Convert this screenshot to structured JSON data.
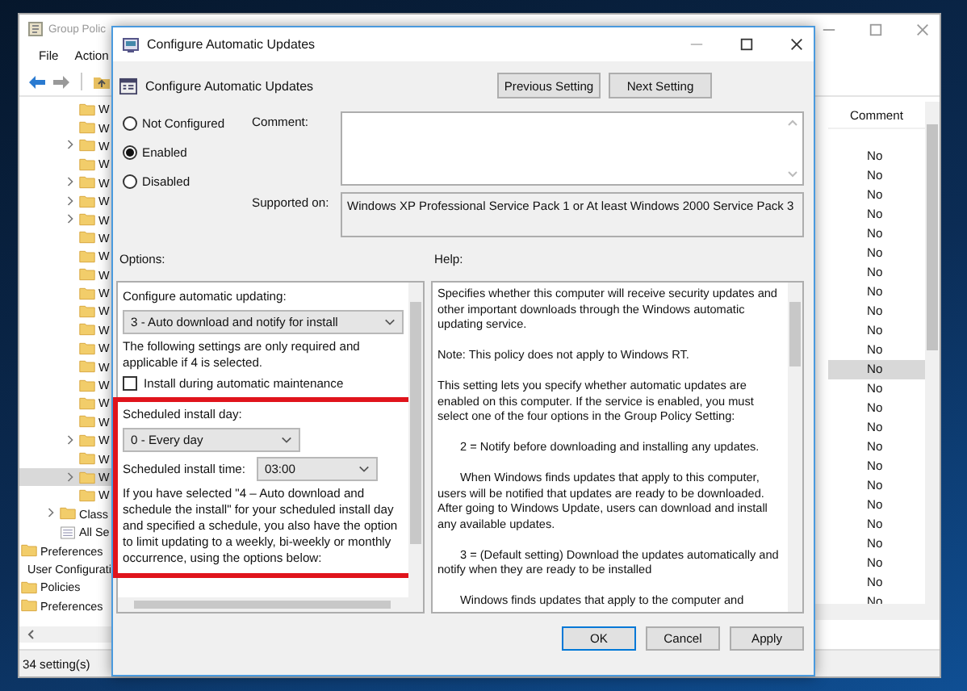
{
  "back_window": {
    "title": "Group Polic",
    "menu": [
      "File",
      "Action"
    ],
    "tree": [
      {
        "children": [
          {
            "children": [
              {
                "children": [
                  {
                    "children": [
                      {
                        "label": "W",
                        "expandable": false,
                        "selected": false
                      },
                      {
                        "label": "W",
                        "expandable": false,
                        "selected": false
                      },
                      {
                        "label": "W",
                        "expandable": true,
                        "selected": false
                      },
                      {
                        "label": "W",
                        "expandable": false,
                        "selected": false
                      },
                      {
                        "label": "W",
                        "expandable": true,
                        "selected": false
                      },
                      {
                        "label": "W",
                        "expandable": true,
                        "selected": false
                      },
                      {
                        "label": "W",
                        "expandable": true,
                        "selected": false
                      },
                      {
                        "label": "W",
                        "expandable": false,
                        "selected": false
                      },
                      {
                        "label": "W",
                        "expandable": false,
                        "selected": false
                      },
                      {
                        "label": "W",
                        "expandable": false,
                        "selected": false
                      },
                      {
                        "label": "W",
                        "expandable": false,
                        "selected": false
                      },
                      {
                        "label": "W",
                        "expandable": false,
                        "selected": false
                      },
                      {
                        "label": "W",
                        "expandable": false,
                        "selected": false
                      },
                      {
                        "label": "W",
                        "expandable": false,
                        "selected": false
                      },
                      {
                        "label": "W",
                        "expandable": false,
                        "selected": false
                      },
                      {
                        "label": "W",
                        "expandable": false,
                        "selected": false
                      },
                      {
                        "label": "W",
                        "expandable": false,
                        "selected": false
                      },
                      {
                        "label": "W",
                        "expandable": false,
                        "selected": false
                      },
                      {
                        "label": "W",
                        "expandable": true,
                        "selected": false
                      },
                      {
                        "label": "W",
                        "expandable": false,
                        "selected": false
                      },
                      {
                        "label": "W",
                        "expandable": true,
                        "selected": true
                      },
                      {
                        "label": "W",
                        "expandable": false,
                        "selected": false
                      }
                    ]
                  },
                  {
                    "label": "Class",
                    "expandable": true,
                    "selected": false
                  },
                  {
                    "label": "All Se",
                    "kind": "settings",
                    "expandable": false,
                    "selected": false
                  }
                ]
              }
            ]
          },
          {
            "label": "Preferences",
            "selected": false
          }
        ]
      },
      {
        "label": "User Configurati",
        "selected": false,
        "children": [
          {
            "label": "Policies",
            "selected": false
          },
          {
            "label": "Preferences",
            "selected": false
          }
        ]
      }
    ],
    "column_header": "Comment",
    "rows": [
      {
        "comment": "No",
        "selected": false
      },
      {
        "comment": "No",
        "selected": false
      },
      {
        "comment": "No",
        "selected": false
      },
      {
        "comment": "No",
        "selected": false
      },
      {
        "comment": "No",
        "selected": false
      },
      {
        "comment": "No",
        "selected": false
      },
      {
        "comment": "No",
        "selected": false
      },
      {
        "comment": "No",
        "selected": false
      },
      {
        "comment": "No",
        "selected": false
      },
      {
        "comment": "No",
        "selected": false
      },
      {
        "comment": "No",
        "selected": false
      },
      {
        "comment": "No",
        "selected": true
      },
      {
        "comment": "No",
        "selected": false
      },
      {
        "comment": "No",
        "selected": false
      },
      {
        "comment": "No",
        "selected": false
      },
      {
        "comment": "No",
        "selected": false
      },
      {
        "comment": "No",
        "selected": false
      },
      {
        "comment": "No",
        "selected": false
      },
      {
        "comment": "No",
        "selected": false
      },
      {
        "comment": "No",
        "selected": false
      },
      {
        "comment": "No",
        "selected": false
      },
      {
        "comment": "No",
        "selected": false
      },
      {
        "comment": "No",
        "selected": false
      },
      {
        "comment": "No",
        "selected": false
      }
    ],
    "status_bar": "34 setting(s)"
  },
  "dialog": {
    "title": "Configure Automatic Updates",
    "heading": "Configure Automatic Updates",
    "nav_buttons": [
      "Previous Setting",
      "Next Setting"
    ],
    "state_options": [
      {
        "label": "Not Configured",
        "selected": false
      },
      {
        "label": "Enabled",
        "selected": true
      },
      {
        "label": "Disabled",
        "selected": false
      }
    ],
    "comment_label": "Comment:",
    "supported_label": "Supported on:",
    "supported_on": "Windows XP Professional Service Pack 1 or At least Windows 2000 Service Pack 3",
    "options_label": "Options:",
    "help_label": "Help:",
    "options": [
      {
        "kind": "label",
        "text": "Configure automatic updating:"
      },
      {
        "kind": "select",
        "value": "3 - Auto download and notify for install"
      },
      {
        "kind": "note",
        "text": "The following settings are only required and applicable if 4 is selected."
      },
      {
        "kind": "checkbox",
        "text": "Install during automatic maintenance",
        "checked": false
      }
    ],
    "highlighted_options": [
      {
        "kind": "label",
        "text": "Scheduled install day:"
      },
      {
        "kind": "select",
        "value": "0 - Every day"
      },
      {
        "kind": "select-row",
        "text": "Scheduled install time:",
        "value": "03:00"
      },
      {
        "kind": "note",
        "text": "If you have selected \"4 – Auto download and schedule the install\" for your scheduled install day and specified a schedule, you also have the option to limit updating to a weekly, bi-weekly or monthly occurrence, using the options below:"
      }
    ],
    "help": [
      {
        "text": "Specifies whether this computer will receive security updates and other important downloads through the Windows automatic updating service.",
        "indent": false
      },
      {
        "text": "Note: This policy does not apply to Windows RT.",
        "indent": false
      },
      {
        "text": "This setting lets you specify whether automatic updates are enabled on this computer. If the service is enabled, you must select one of the four options in the Group Policy Setting:",
        "indent": false
      },
      {
        "text": "2 = Notify before downloading and installing any updates.",
        "indent": true
      },
      {
        "text": "When Windows finds updates that apply to this computer, users will be notified that updates are ready to be downloaded. After going to Windows Update, users can download and install any available updates.",
        "indent": true
      },
      {
        "text": "3 = (Default setting) Download the updates automatically and notify when they are ready to be installed",
        "indent": true
      },
      {
        "text": "Windows finds updates that apply to the computer and",
        "indent": true
      }
    ],
    "buttons": [
      {
        "label": "OK",
        "default": true
      },
      {
        "label": "Cancel",
        "default": false
      },
      {
        "label": "Apply",
        "default": false
      }
    ]
  }
}
